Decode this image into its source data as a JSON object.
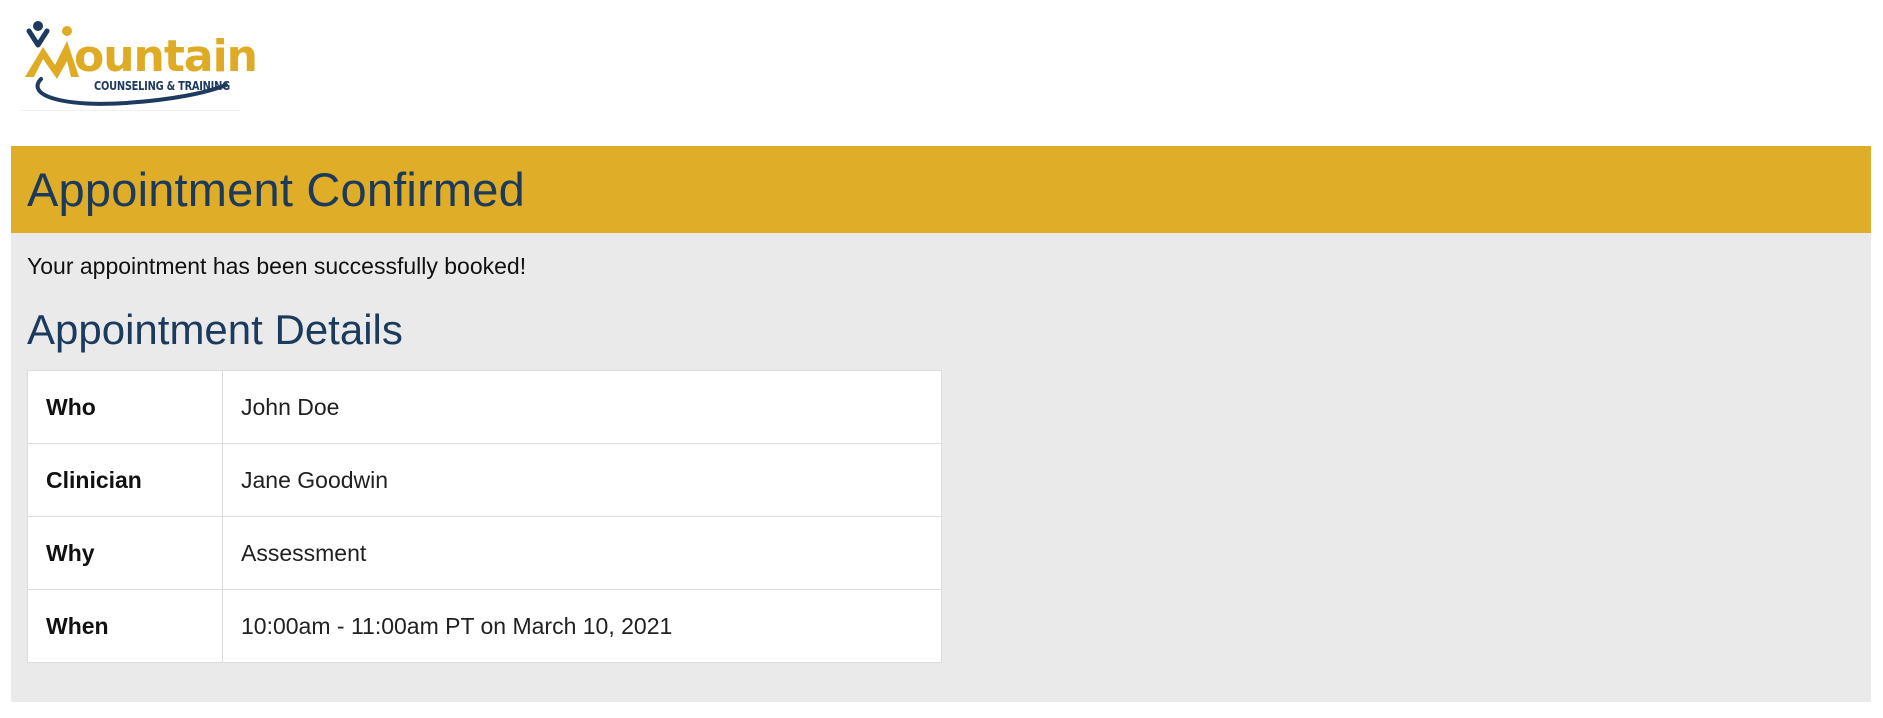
{
  "logo": {
    "word": "ountain",
    "subtitle": "COUNSELING & TRAINING"
  },
  "banner": {
    "title": "Appointment Confirmed"
  },
  "message": "Your appointment has been successfully booked!",
  "details": {
    "heading": "Appointment Details",
    "rows": [
      {
        "label": "Who",
        "value": "John Doe"
      },
      {
        "label": "Clinician",
        "value": "Jane Goodwin"
      },
      {
        "label": "Why",
        "value": "Assessment"
      },
      {
        "label": "When",
        "value": "10:00am - 11:00am PT on March 10, 2021"
      }
    ]
  },
  "colors": {
    "brand_gold": "#dfad27",
    "brand_navy": "#1b3a5c",
    "panel_bg": "#eaeaea"
  }
}
